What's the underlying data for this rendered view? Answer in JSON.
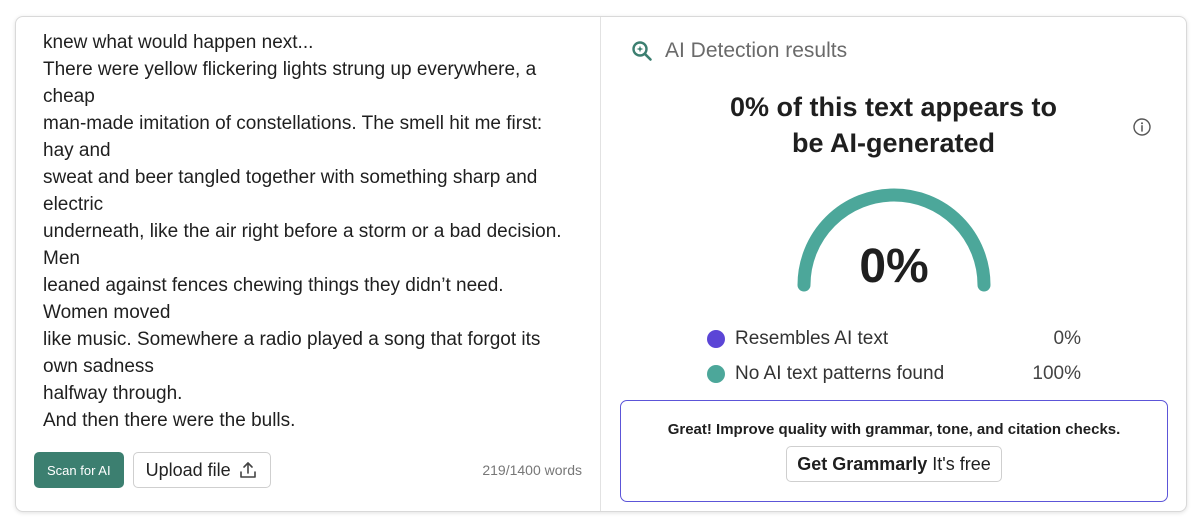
{
  "editor": {
    "lines": [
      "knew what would happen next...",
      "There were yellow flickering lights strung up everywhere, a",
      "cheap",
      "man-made imitation of constellations. The smell hit me first:",
      "hay and",
      "sweat and beer tangled together with something sharp and",
      "electric",
      "underneath, like the air right before a storm or a bad decision.",
      "Men",
      "leaned against fences chewing things they didn’t need.",
      "Women moved",
      "like music. Somewhere a radio played a song that forgot its",
      "own sadness",
      "halfway through.",
      "And then there were the bulls."
    ],
    "scan_label": "Scan for AI",
    "upload_label": "Upload file",
    "word_count": "219/1400 words"
  },
  "results": {
    "title": "AI Detection results",
    "headline_line1": "0% of this text appears to",
    "headline_line2": "be AI-generated",
    "gauge_value": "0%",
    "gauge_fraction": 0,
    "legend": [
      {
        "label": "Resembles AI text",
        "value": "0%",
        "color": "#5b45d6"
      },
      {
        "label": "No AI text patterns found",
        "value": "100%",
        "color": "#4ca79a"
      }
    ]
  },
  "promo": {
    "text": "Great! Improve quality with grammar, tone, and citation checks.",
    "button_strong": "Get Grammarly",
    "button_rest": "It's free"
  },
  "colors": {
    "accent_green": "#3c7f70",
    "gauge_teal": "#4ca79a",
    "ai_purple": "#5b45d6",
    "promo_border": "#5c55d8"
  },
  "icons": [
    "upload-icon",
    "search-sparkle-icon",
    "info-icon"
  ]
}
